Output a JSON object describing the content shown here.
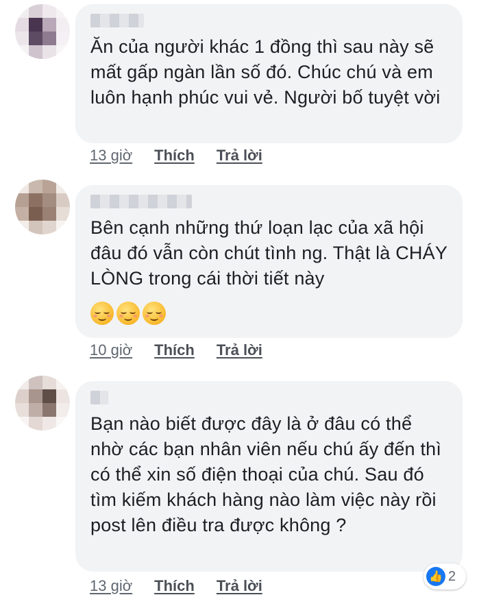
{
  "comments": [
    {
      "text": "Ăn của người khác 1 đồng thì sau này sẽ mất gấp ngàn lần số đó. Chúc chú và em luôn hạnh phúc vui vẻ. Người bố tuyệt vời",
      "time": "13 giờ",
      "like_label": "Thích",
      "reply_label": "Trả lời"
    },
    {
      "text": "Bên cạnh những thứ loạn lạc của xã hội đâu đó vẫn còn chút tình ng. Thật là CHÁY LÒNG trong cái thời tiết này",
      "emojis": [
        "relieved-face-icon",
        "relieved-face-icon",
        "relieved-face-icon"
      ],
      "time": "10 giờ",
      "like_label": "Thích",
      "reply_label": "Trả lời"
    },
    {
      "text": "Bạn nào biết được đây là ở đâu có thể nhờ các bạn nhân viên nếu chú ấy đến thì có thể xin số điện thoại của chú. Sau đó tìm kiếm khách hàng nào làm việc này rồi post lên điều tra được không ?",
      "time": "13 giờ",
      "like_label": "Thích",
      "reply_label": "Trả lời",
      "reactions": {
        "icon": "like-icon",
        "count": "2"
      }
    }
  ],
  "colors": {
    "bubble": "#f2f3f5",
    "text": "#1c1e21",
    "meta": "#606770",
    "like_blue": "#1877f2"
  }
}
